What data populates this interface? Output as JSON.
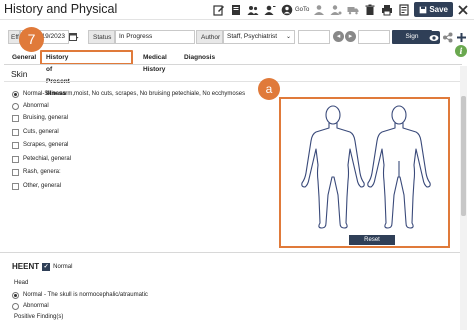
{
  "window": {
    "title": "History and Physical"
  },
  "toolbar": {
    "goto_label": "GoTo",
    "save_label": "Save"
  },
  "header": {
    "date_prefix": "Eff",
    "date_value": "/19/2023",
    "status_label": "Status",
    "status_value": "In Progress",
    "author_label": "Author",
    "author_value": "Staff, Psychiatrist",
    "sign_label": "Sign"
  },
  "tabs": [
    {
      "label": "General"
    },
    {
      "label": "History of Present Illness"
    },
    {
      "label": "Medical History"
    },
    {
      "label": "Diagnosis"
    }
  ],
  "skin": {
    "title": "Skin",
    "options": [
      {
        "label": "Normal-Skin warm,moist, No cuts, scrapes, No bruising petechiale, No ecchymoses",
        "type": "radio",
        "checked": true
      },
      {
        "label": "Abnormal",
        "type": "radio",
        "checked": false
      },
      {
        "label": "Bruising, general",
        "type": "checkbox",
        "checked": false
      },
      {
        "label": "Cuts, general",
        "type": "checkbox",
        "checked": false
      },
      {
        "label": "Scrapes, general",
        "type": "checkbox",
        "checked": false
      },
      {
        "label": "Petechial, general",
        "type": "checkbox",
        "checked": false
      },
      {
        "label": "Rash, genera:",
        "type": "checkbox",
        "checked": false
      },
      {
        "label": "Other, general",
        "type": "checkbox",
        "checked": false
      }
    ]
  },
  "bodymap": {
    "reset_label": "Reset"
  },
  "callouts": {
    "step": "7",
    "marker": "a"
  },
  "heent": {
    "title": "HEENT",
    "normal_label": "Normal",
    "head_label": "Head",
    "head_normal": "Normal - The skull is normocephalic/atraumatic",
    "head_abnormal": "Abnormal",
    "positive_findings": "Positive Finding(s)"
  },
  "colors": {
    "accent": "#e07a3a",
    "primary": "#2f3f57",
    "info": "#6aa84f"
  }
}
